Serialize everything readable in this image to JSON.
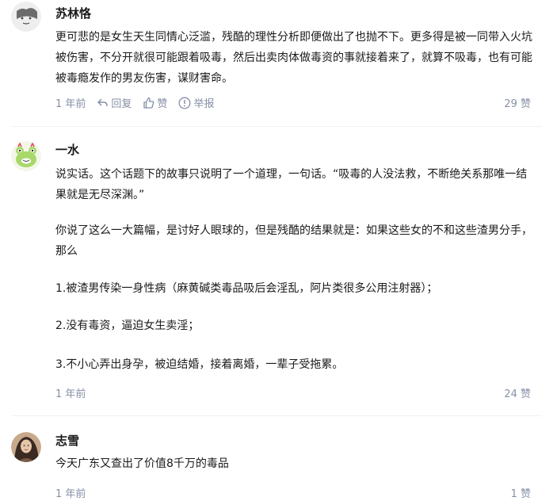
{
  "comments": [
    {
      "author": "苏林恪",
      "avatar_icon": "gray-default-avatar",
      "paragraphs": [
        "更可悲的是女生天生同情心泛滥，残酷的理性分析即便做出了也抛不下。更多得是被一同带入火坑被伤害，不分开就很可能跟着吸毒，然后出卖肉体做毒资的事就接着来了，就算不吸毒，也有可能被毒瘾发作的男友伤害，谋财害命。"
      ],
      "time": "1 年前",
      "reply_label": "回复",
      "like_label": "赞",
      "report_label": "举报",
      "likes": "29 赞"
    },
    {
      "author": "一水",
      "avatar_icon": "green-frog-avatar",
      "paragraphs": [
        "说实话。这个话题下的故事只说明了一个道理，一句话。“吸毒的人没法救，不断绝关系那唯一结果就是无尽深渊。”",
        "你说了这么一大篇幅，是讨好人眼球的，但是残酷的结果就是：如果这些女的不和这些渣男分手，那么",
        "1.被渣男传染一身性病（麻黄碱类毒品吸后会淫乱，阿片类很多公用注射器）；",
        "2.没有毒资，逼迫女生卖淫；",
        "3.不小心弄出身孕，被迫结婚，接着离婚，一辈子受拖累。"
      ],
      "time": "1 年前",
      "likes": "24 赞"
    },
    {
      "author": "志雪",
      "avatar_icon": "photo-avatar",
      "paragraphs": [
        "今天广东又查出了价值8千万的毒品"
      ],
      "time": "1 年前",
      "likes": "1 赞"
    }
  ]
}
